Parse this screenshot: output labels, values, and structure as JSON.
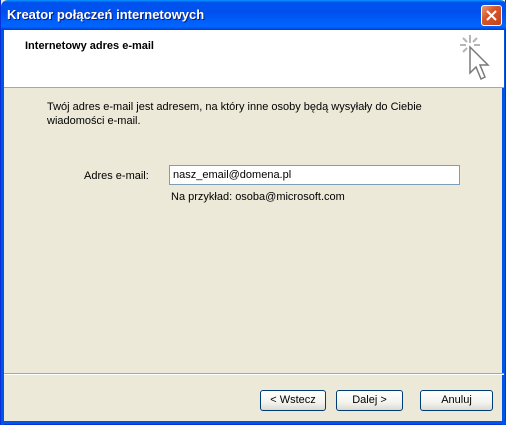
{
  "window": {
    "title": "Kreator połączeń internetowych"
  },
  "header": {
    "title": "Internetowy adres e-mail",
    "icon": "wizard-cursor-icon"
  },
  "content": {
    "intro_line1": "Twój adres e-mail jest adresem, na który inne osoby będą wysyłały do Ciebie",
    "intro_line2": "wiadomości e-mail.",
    "email_label": "Adres e-mail:",
    "email_value": "nasz_email@domena.pl",
    "example_text": "Na przykład: osoba@microsoft.com"
  },
  "buttons": {
    "back": "< Wstecz",
    "next": "Dalej >",
    "cancel": "Anuluj"
  },
  "colors": {
    "titlebar": "#0053ee",
    "window_bg": "#ece9d8",
    "close_button": "#d6562c"
  }
}
